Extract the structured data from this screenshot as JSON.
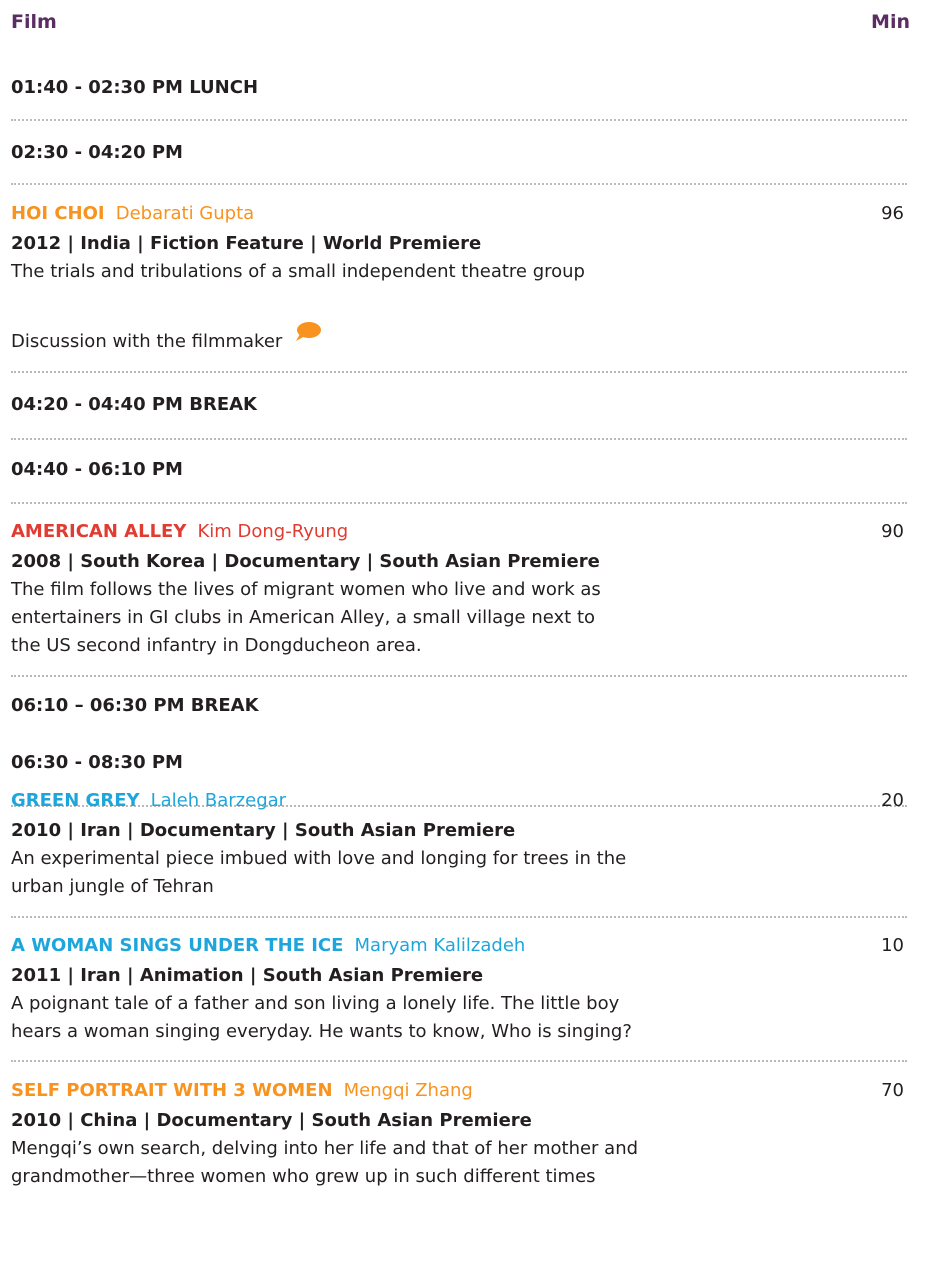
{
  "header": {
    "film_label": "Film",
    "min_label": "Min"
  },
  "colors": {
    "header": "#5a2d63",
    "orange": "#f7931e",
    "red": "#e03c31",
    "blue": "#1ea6dc",
    "divider": "#b9b9b9"
  },
  "slots": {
    "lunch": "01:40 - 02:30 PM LUNCH",
    "s1": "02:30 - 04:20 PM",
    "break1": "04:20 - 04:40 PM BREAK",
    "s2": "04:40 - 06:10 PM",
    "break2": "06:10 – 06:30 PM BREAK",
    "s3": "06:30 - 08:30 PM"
  },
  "films": [
    {
      "title": "HOI CHOI",
      "director": "Debarati Gupta",
      "minutes": "96",
      "meta": "2012 | India | Fiction Feature |  World Premiere",
      "desc": [
        "The trials and tribulations of a small independent theatre group"
      ],
      "discussion": "Discussion with the filmmaker",
      "icon": "speech-bubble-icon"
    },
    {
      "title": "AMERICAN ALLEY",
      "director": "Kim Dong-Ryung",
      "minutes": "90",
      "meta": "2008 | South Korea | Documentary |  South Asian Premiere",
      "desc": [
        "The film follows the lives of migrant women who live and work as",
        "entertainers in GI clubs in American Alley, a small village next to",
        "the US second infantry in Dongducheon area."
      ]
    },
    {
      "title": "GREEN GREY",
      "director": "Laleh Barzegar",
      "minutes": "20",
      "meta": "2010 | Iran | Documentary |  South Asian Premiere",
      "desc": [
        "An experimental piece imbued with love and longing for trees in the",
        "urban jungle of Tehran"
      ]
    },
    {
      "title": "A WOMAN SINGS UNDER THE ICE",
      "director": "Maryam Kalilzadeh",
      "minutes": "10",
      "meta": "2011 | Iran | Animation | South Asian Premiere",
      "desc": [
        "A poignant tale of a father and son living a lonely life. The little boy",
        "hears a woman singing everyday. He wants to know, Who is singing?"
      ]
    },
    {
      "title": "SELF PORTRAIT WITH 3 WOMEN",
      "director": "Mengqi Zhang",
      "minutes": "70",
      "meta": "2010 | China | Documentary | South Asian Premiere",
      "desc": [
        "Mengqi’s own search, delving into her life and that of her mother and",
        "grandmother—three women who grew up in such different times"
      ]
    }
  ]
}
